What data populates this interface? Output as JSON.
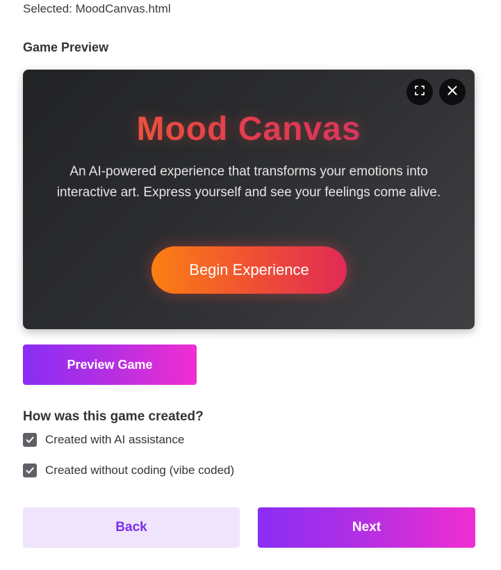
{
  "file": {
    "selected_text": "Selected: MoodCanvas.html"
  },
  "preview": {
    "section_label": "Game Preview",
    "fullscreen_icon": "fullscreen-icon",
    "close_icon": "close-icon",
    "game": {
      "title": "Mood Canvas",
      "description": "An AI-powered experience that transforms your emotions into interactive art. Express yourself and see your feelings come alive.",
      "cta_label": "Begin Experience",
      "title_gradient": [
        "#f7672b",
        "#e23a53",
        "#c9287a"
      ],
      "cta_gradient": [
        "#fb7f12",
        "#e12a55"
      ],
      "background": "#2c2d30"
    },
    "preview_button_label": "Preview Game"
  },
  "creation": {
    "question": "How was this game created?",
    "options": [
      {
        "label": "Created with AI assistance",
        "checked": true
      },
      {
        "label": "Created without coding (vibe coded)",
        "checked": true
      }
    ]
  },
  "navigation": {
    "back_label": "Back",
    "next_label": "Next"
  },
  "colors": {
    "accent_purple": "#8a2df5",
    "accent_pink": "#f02ed1",
    "back_bg": "#efe4fc",
    "back_text": "#7a2ee6",
    "checkbox": "#5f6066"
  }
}
